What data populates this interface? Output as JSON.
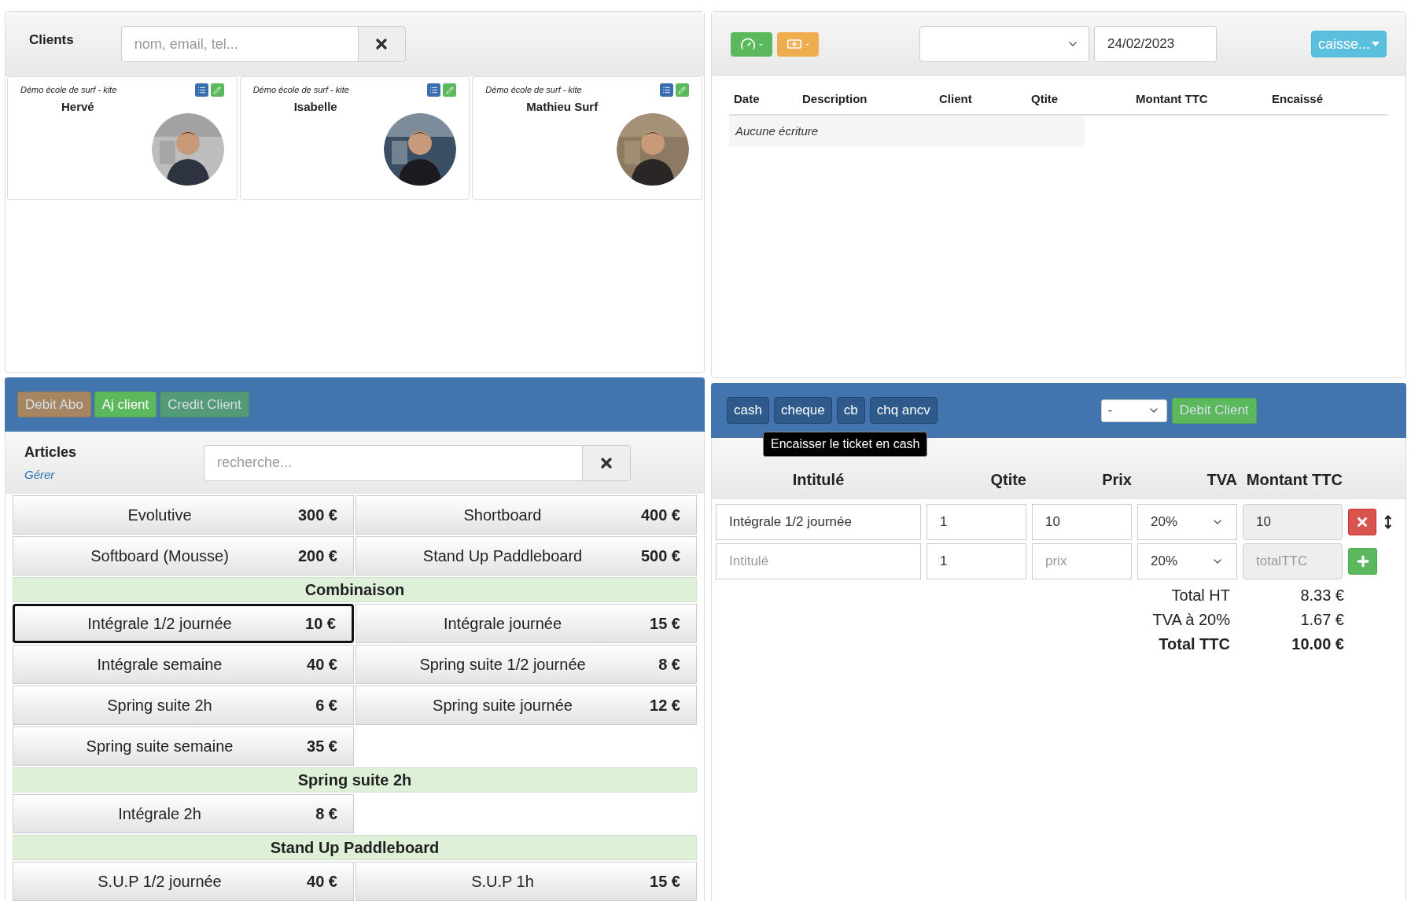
{
  "clients": {
    "title": "Clients",
    "search": {
      "placeholder": "nom, email, tel..."
    },
    "cards": [
      {
        "school": "Démo école de surf - kite",
        "name": "Hervé",
        "kind": "picture"
      },
      {
        "school": "Démo école de surf - kite",
        "name": "Isabelle",
        "kind": "picture"
      },
      {
        "school": "Démo école de surf - kite",
        "name": "Mathieu Surf",
        "kind": "picture"
      }
    ]
  },
  "caisse_bar": {
    "badges": [
      {
        "kind": "gauge",
        "label": "-",
        "color": "#5cb85c"
      },
      {
        "kind": "money",
        "label": "-",
        "color": "#f0ad4e"
      }
    ],
    "date": "24/02/2023",
    "menu_button": "caisse..."
  },
  "journal": {
    "columns": [
      "Date",
      "Description",
      "Client",
      "Qtite",
      "Montant TTC",
      "Encaissé"
    ],
    "empty_text": "Aucune écriture"
  },
  "client_actions": [
    {
      "label": "Debit Abo",
      "color": "#a68562",
      "disabled": true
    },
    {
      "label": "Aj client",
      "color": "#5cb85c",
      "disabled": false
    },
    {
      "label": "Credit Client",
      "color": "#529a78",
      "disabled": true
    }
  ],
  "payment_bar": {
    "methods": [
      "cash",
      "cheque",
      "cb",
      "chq ancv"
    ],
    "select_value": "-",
    "debit_button": {
      "label": "Debit Client",
      "disabled": true
    },
    "tooltip": "Encaisser le ticket en cash"
  },
  "articles": {
    "title": "Articles",
    "manage_link": "Gérer",
    "search": {
      "placeholder": "recherche..."
    },
    "sections": [
      {
        "items": [
          {
            "name": "Evolutive",
            "price": "300 €",
            "selected": false
          },
          {
            "name": "Shortboard",
            "price": "400 €",
            "selected": false
          },
          {
            "name": "Softboard (Mousse)",
            "price": "200 €",
            "selected": false
          },
          {
            "name": "Stand Up Paddleboard",
            "price": "500 €",
            "selected": false
          }
        ]
      },
      {
        "title": "Combinaison",
        "items": [
          {
            "name": "Intégrale 1/2 journée",
            "price": "10 €",
            "selected": true
          },
          {
            "name": "Intégrale journée",
            "price": "15 €",
            "selected": false
          },
          {
            "name": "Intégrale semaine",
            "price": "40 €",
            "selected": false
          },
          {
            "name": "Spring suite 1/2 journée",
            "price": "8 €",
            "selected": false
          },
          {
            "name": "Spring suite 2h",
            "price": "6 €",
            "selected": false
          },
          {
            "name": "Spring suite journée",
            "price": "12 €",
            "selected": false
          },
          {
            "name": "Spring suite semaine",
            "price": "35 €",
            "selected": false
          }
        ]
      },
      {
        "title": "Spring suite 2h",
        "items": [
          {
            "name": "Intégrale 2h",
            "price": "8 €",
            "selected": false
          }
        ]
      },
      {
        "title": "Stand Up Paddleboard",
        "items": [
          {
            "name": "S.U.P 1/2 journée",
            "price": "40 €",
            "selected": false
          },
          {
            "name": "S.U.P 1h",
            "price": "15 €",
            "selected": false
          }
        ]
      }
    ]
  },
  "ticket": {
    "columns": [
      "Intitulé",
      "Qtite",
      "Prix",
      "TVA",
      "Montant TTC"
    ],
    "lines": [
      {
        "kind": "item",
        "label": "Intégrale 1/2 journée",
        "qty": "1",
        "price": "10",
        "tva": "20%",
        "total": "10"
      },
      {
        "kind": "new",
        "label_placeholder": "Intitulé",
        "qty": "1",
        "price_placeholder": "prix",
        "tva": "20%",
        "total_placeholder": "totalTTC"
      }
    ],
    "totals": [
      {
        "label": "Total HT",
        "value": "8.33 €",
        "bold": false
      },
      {
        "label": "TVA à 20%",
        "value": "1.67 €",
        "bold": false
      },
      {
        "label": "Total TTC",
        "value": "10.00 €",
        "bold": true
      }
    ]
  }
}
